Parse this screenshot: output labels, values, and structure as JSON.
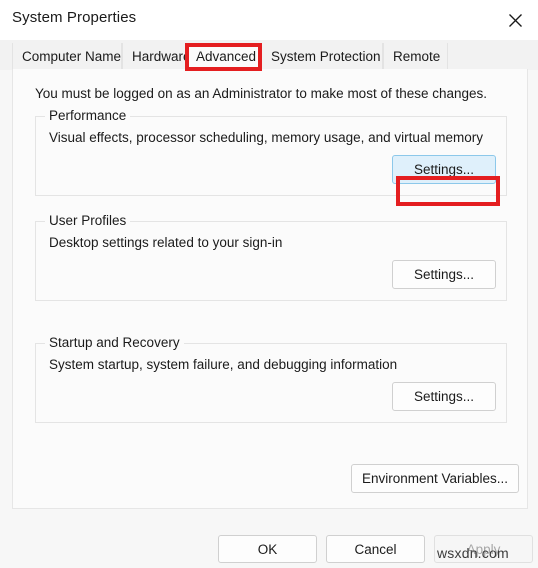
{
  "window": {
    "title": "System Properties",
    "close_icon": "close-icon"
  },
  "tabs": [
    {
      "label": "Computer Name",
      "selected": false
    },
    {
      "label": "Hardware",
      "selected": false
    },
    {
      "label": "Advanced",
      "selected": true
    },
    {
      "label": "System Protection",
      "selected": false
    },
    {
      "label": "Remote",
      "selected": false
    }
  ],
  "panel": {
    "admin_note": "You must be logged on as an Administrator to make most of these changes.",
    "groups": [
      {
        "legend": "Performance",
        "description": "Visual effects, processor scheduling, memory usage, and virtual memory",
        "button_label": "Settings...",
        "button_state": "focused"
      },
      {
        "legend": "User Profiles",
        "description": "Desktop settings related to your sign-in",
        "button_label": "Settings...",
        "button_state": "normal"
      },
      {
        "legend": "Startup and Recovery",
        "description": "System startup, system failure, and debugging information",
        "button_label": "Settings...",
        "button_state": "normal"
      }
    ],
    "environment_variables_label": "Environment Variables..."
  },
  "footer": {
    "ok_label": "OK",
    "cancel_label": "Cancel",
    "apply_label": "Apply",
    "apply_enabled": false
  },
  "annotations": {
    "highlight_color": "#e41e20",
    "targets": [
      "Advanced",
      "Settings..."
    ]
  },
  "watermark": {
    "text": "wsxdn.com"
  }
}
